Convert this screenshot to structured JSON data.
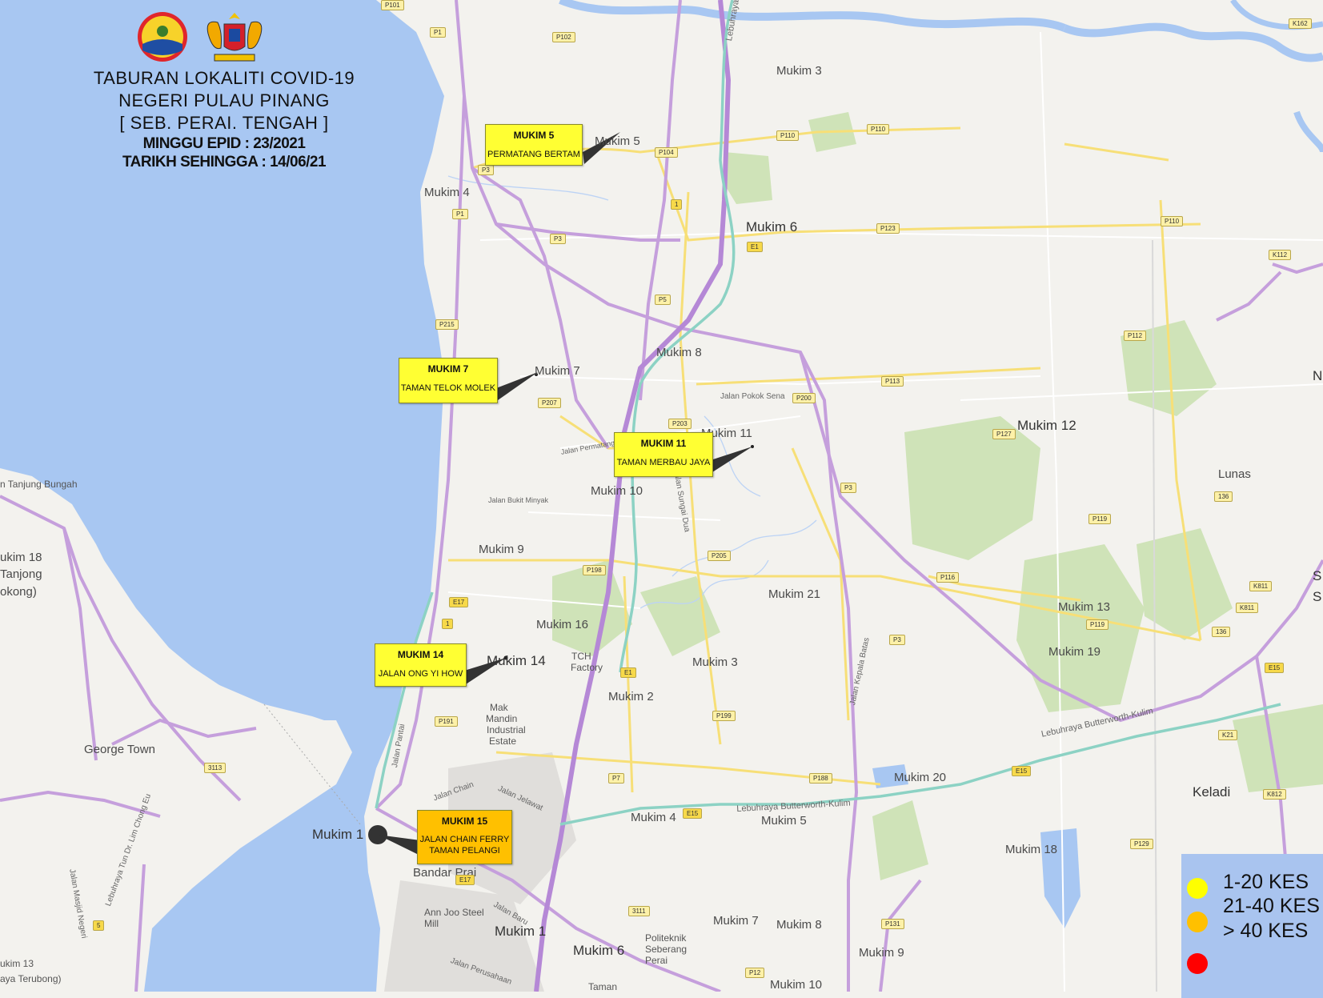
{
  "header": {
    "line1": "TABURAN LOKALITI COVID-19",
    "line2": "NEGERI PULAU PINANG",
    "line3": "[ SEB. PERAI. TENGAH ]",
    "line4": "MINGGU EPID : 23/2021",
    "line5": "TARIKH SEHINGGA : 14/06/21"
  },
  "callouts": [
    {
      "title": "MUKIM 5",
      "subtitle": "PERMATANG BERTAM",
      "color": "#ffff33"
    },
    {
      "title": "MUKIM 7",
      "subtitle": "TAMAN TELOK MOLEK",
      "color": "#ffff33"
    },
    {
      "title": "MUKIM 11",
      "subtitle": "TAMAN MERBAU JAYA",
      "color": "#ffff33"
    },
    {
      "title": "MUKIM 14",
      "subtitle": "JALAN ONG YI HOW",
      "color": "#ffff33"
    },
    {
      "title": "MUKIM 15",
      "subtitle": "JALAN CHAIN FERRY\nTAMAN PELANGI",
      "color": "#ffc000"
    }
  ],
  "legend": {
    "items": [
      {
        "label": "1-20 KES",
        "color": "#ffff00"
      },
      {
        "label": "21-40 KES",
        "color": "#ffc000"
      },
      {
        "label": "> 40 KES",
        "color": "#ff0000"
      }
    ]
  },
  "places": [
    {
      "text": "Mukim 3"
    },
    {
      "text": "Mukim 5"
    },
    {
      "text": "Mukim 4"
    },
    {
      "text": "Mukim 6"
    },
    {
      "text": "Mukim 7"
    },
    {
      "text": "Mukim 8"
    },
    {
      "text": "Mukim 11"
    },
    {
      "text": "Mukim 10"
    },
    {
      "text": "Mukim 12"
    },
    {
      "text": "Lunas"
    },
    {
      "text": "Mukim 9"
    },
    {
      "text": "Mukim 21"
    },
    {
      "text": "Mukim 13"
    },
    {
      "text": "Mukim 16"
    },
    {
      "text": "Mukim 14"
    },
    {
      "text": "Mukim 3"
    },
    {
      "text": "Mukim 19"
    },
    {
      "text": "Mukim 2"
    },
    {
      "text": "George Town"
    },
    {
      "text": "Mukim 20"
    },
    {
      "text": "Keladi"
    },
    {
      "text": "Mukim 4"
    },
    {
      "text": "Mukim 5"
    },
    {
      "text": "Mukim 1"
    },
    {
      "text": "Mukim 18"
    },
    {
      "text": "Bandar Prai"
    },
    {
      "text": "Mukim 1"
    },
    {
      "text": "Mukim 6"
    },
    {
      "text": "Mukim 7"
    },
    {
      "text": "Mukim 8"
    },
    {
      "text": "Mukim 9"
    },
    {
      "text": "Mukim 10"
    },
    {
      "text": "ukim 18"
    },
    {
      "text": "Tanjong"
    },
    {
      "text": "okong)"
    },
    {
      "text": "n Tanjung Bungah"
    },
    {
      "text": "ukim 13"
    },
    {
      "text": "aya Terubong)"
    },
    {
      "text": "TCH"
    },
    {
      "text": "Factory"
    },
    {
      "text": "Mak"
    },
    {
      "text": "Mandin"
    },
    {
      "text": "Industrial"
    },
    {
      "text": "Estate"
    },
    {
      "text": "Ann Joo Steel"
    },
    {
      "text": "Mill"
    },
    {
      "text": "Politeknik"
    },
    {
      "text": "Seberang"
    },
    {
      "text": "Perai"
    },
    {
      "text": "Taman"
    },
    {
      "text": "N"
    },
    {
      "text": "S"
    },
    {
      "text": "S"
    }
  ],
  "roads": [
    {
      "text": "Lebuhraya Utara Selatan"
    },
    {
      "text": "Lebuhraya Butterworth-Kulim"
    },
    {
      "text": "Lebuhraya Butterworth-Kulim"
    },
    {
      "text": "Jalan Pokok Sena"
    },
    {
      "text": "Jalan Kepala Batas"
    },
    {
      "text": "Jalan Pantai"
    },
    {
      "text": "Jalan Jelawat"
    },
    {
      "text": "Jalan Chain"
    },
    {
      "text": "Jalan Baru"
    },
    {
      "text": "Jalan Perusahaan"
    },
    {
      "text": "Lebuhraya Tun Dr. Lim Chong Eu"
    },
    {
      "text": "Jalan Masjid Negeri"
    },
    {
      "text": "Jalan Sungai Dua"
    },
    {
      "text": "Jalan Permatang Darat"
    },
    {
      "text": "Jalan Bukit Minyak"
    }
  ],
  "shields": [
    "P101",
    "P1",
    "P102",
    "P110",
    "P110",
    "P104",
    "P3",
    "1",
    "P123",
    "P1",
    "P3",
    "E1",
    "P5",
    "P215",
    "P200",
    "P113",
    "P207",
    "P203",
    "P127",
    "P3",
    "P205",
    "P119",
    "P198",
    "P116",
    "E17",
    "1",
    "P3",
    "P119",
    "K811",
    "K811",
    "E1",
    "P191",
    "P199",
    "E15",
    "K21",
    "3113",
    "E15",
    "P188",
    "P7",
    "E15",
    "K812",
    "P129",
    "E17",
    "3111",
    "P131",
    "P12",
    "5",
    "P112",
    "P110",
    "K112",
    "136",
    "136",
    "K162"
  ]
}
